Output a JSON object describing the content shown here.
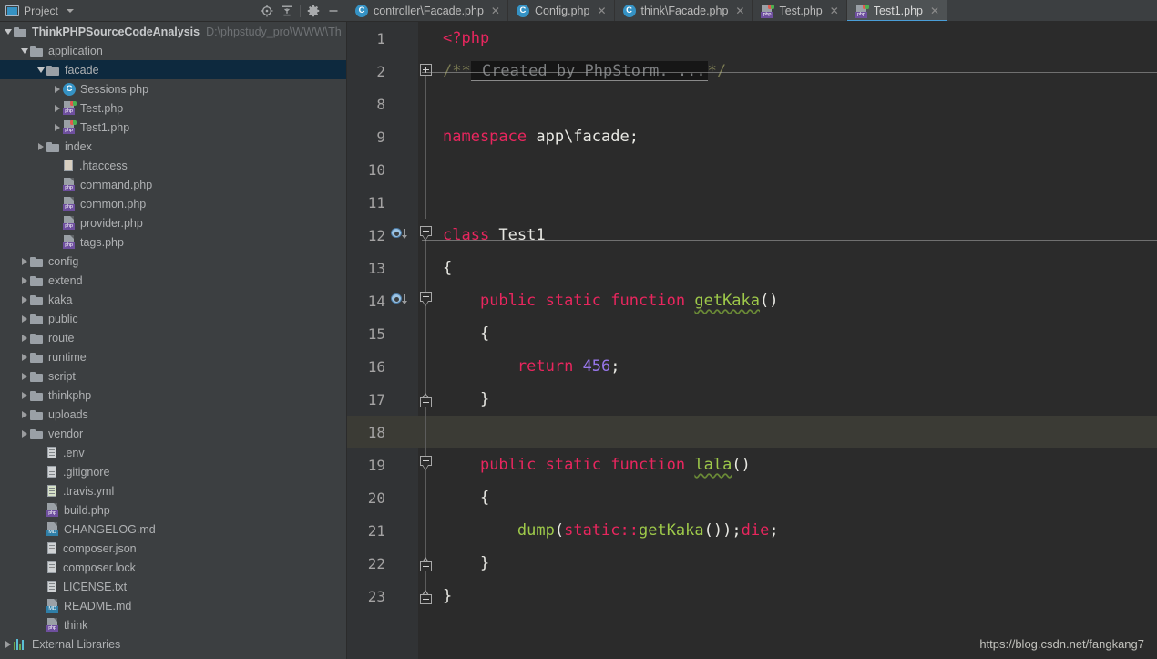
{
  "project_panel": {
    "title": "Project",
    "icon": "project-window-icon",
    "dropdown_icon": "chevron-down-icon",
    "toolbar": [
      {
        "name": "locate-file-icon",
        "label": "Select Opened File"
      },
      {
        "name": "collapse-all-icon",
        "label": "Collapse All"
      },
      {
        "name": "gear-icon",
        "label": "Settings"
      },
      {
        "name": "minimize-icon",
        "label": "Hide"
      }
    ],
    "tree": [
      {
        "label": "ThinkPHPSourceCodeAnalysis",
        "path": "D:\\phpstudy_pro\\WWW\\Th",
        "indent": 0,
        "arrow": "down",
        "icon": "folder-icon",
        "root": true,
        "selected": false
      },
      {
        "label": "application",
        "indent": 1,
        "arrow": "down",
        "icon": "folder-icon",
        "selected": false
      },
      {
        "label": "facade",
        "indent": 2,
        "arrow": "down",
        "icon": "folder-icon",
        "selected": true
      },
      {
        "label": "Sessions.php",
        "indent": 3,
        "arrow": "right",
        "icon": "php-class-icon",
        "selected": false
      },
      {
        "label": "Test.php",
        "indent": 3,
        "arrow": "right",
        "icon": "php-file-icon",
        "selected": false
      },
      {
        "label": "Test1.php",
        "indent": 3,
        "arrow": "right",
        "icon": "php-file-icon",
        "selected": false
      },
      {
        "label": "index",
        "indent": 2,
        "arrow": "right",
        "icon": "folder-icon",
        "selected": false
      },
      {
        "label": ".htaccess",
        "indent": 3,
        "arrow": "none",
        "icon": "htaccess-file-icon",
        "selected": false
      },
      {
        "label": "command.php",
        "indent": 3,
        "arrow": "none",
        "icon": "php-file-icon",
        "selected": false
      },
      {
        "label": "common.php",
        "indent": 3,
        "arrow": "none",
        "icon": "php-file-icon",
        "selected": false
      },
      {
        "label": "provider.php",
        "indent": 3,
        "arrow": "none",
        "icon": "php-file-icon",
        "selected": false
      },
      {
        "label": "tags.php",
        "indent": 3,
        "arrow": "none",
        "icon": "php-file-icon",
        "selected": false
      },
      {
        "label": "config",
        "indent": 1,
        "arrow": "right",
        "icon": "folder-icon",
        "selected": false
      },
      {
        "label": "extend",
        "indent": 1,
        "arrow": "right",
        "icon": "folder-icon",
        "selected": false
      },
      {
        "label": "kaka",
        "indent": 1,
        "arrow": "right",
        "icon": "folder-icon",
        "selected": false
      },
      {
        "label": "public",
        "indent": 1,
        "arrow": "right",
        "icon": "folder-icon",
        "selected": false
      },
      {
        "label": "route",
        "indent": 1,
        "arrow": "right",
        "icon": "folder-icon",
        "selected": false
      },
      {
        "label": "runtime",
        "indent": 1,
        "arrow": "right",
        "icon": "folder-icon",
        "selected": false
      },
      {
        "label": "script",
        "indent": 1,
        "arrow": "right",
        "icon": "folder-icon",
        "selected": false
      },
      {
        "label": "thinkphp",
        "indent": 1,
        "arrow": "right",
        "icon": "folder-icon",
        "selected": false
      },
      {
        "label": "uploads",
        "indent": 1,
        "arrow": "right",
        "icon": "folder-icon",
        "selected": false
      },
      {
        "label": "vendor",
        "indent": 1,
        "arrow": "right",
        "icon": "folder-icon",
        "selected": false
      },
      {
        "label": ".env",
        "indent": 2,
        "arrow": "none",
        "icon": "text-file-icon",
        "selected": false
      },
      {
        "label": ".gitignore",
        "indent": 2,
        "arrow": "none",
        "icon": "text-file-icon",
        "selected": false
      },
      {
        "label": ".travis.yml",
        "indent": 2,
        "arrow": "none",
        "icon": "yaml-file-icon",
        "selected": false
      },
      {
        "label": "build.php",
        "indent": 2,
        "arrow": "none",
        "icon": "php-file-icon",
        "selected": false
      },
      {
        "label": "CHANGELOG.md",
        "indent": 2,
        "arrow": "none",
        "icon": "markdown-file-icon",
        "selected": false
      },
      {
        "label": "composer.json",
        "indent": 2,
        "arrow": "none",
        "icon": "composer-file-icon",
        "selected": false
      },
      {
        "label": "composer.lock",
        "indent": 2,
        "arrow": "none",
        "icon": "composer-file-icon",
        "selected": false
      },
      {
        "label": "LICENSE.txt",
        "indent": 2,
        "arrow": "none",
        "icon": "text-file-icon",
        "selected": false
      },
      {
        "label": "README.md",
        "indent": 2,
        "arrow": "none",
        "icon": "markdown-file-icon",
        "selected": false
      },
      {
        "label": "think",
        "indent": 2,
        "arrow": "none",
        "icon": "php-file-icon",
        "selected": false
      },
      {
        "label": "External Libraries",
        "indent": 0,
        "arrow": "right",
        "icon": "external-libraries-icon",
        "selected": false
      }
    ]
  },
  "editor_tabs": [
    {
      "label": "controller\\Facade.php",
      "icon": "php-class-icon",
      "active": false,
      "close_icon": "close-icon"
    },
    {
      "label": "Config.php",
      "icon": "php-class-icon",
      "active": false,
      "close_icon": "close-icon"
    },
    {
      "label": "think\\Facade.php",
      "icon": "php-class-icon",
      "active": false,
      "close_icon": "close-icon"
    },
    {
      "label": "Test.php",
      "icon": "php-file-icon",
      "active": false,
      "close_icon": "close-icon"
    },
    {
      "label": "Test1.php",
      "icon": "php-file-icon",
      "active": true,
      "close_icon": "close-icon"
    }
  ],
  "editor": {
    "active_line": 18,
    "accent_color": "#4a9ed8",
    "background": "#2b2b2b",
    "gutter_background": "#313335",
    "current_line_background": "#3b3b35",
    "fold_placeholder": " Created by PhpStorm. ...",
    "lines": [
      {
        "num": "1",
        "text": "<?php"
      },
      {
        "num": "2",
        "text": "/** Created by PhpStorm. ...*/"
      },
      {
        "num": "8",
        "text": ""
      },
      {
        "num": "9",
        "text": "namespace app\\facade;"
      },
      {
        "num": "10",
        "text": ""
      },
      {
        "num": "11",
        "text": ""
      },
      {
        "num": "12",
        "text": "class Test1"
      },
      {
        "num": "13",
        "text": "{"
      },
      {
        "num": "14",
        "text": "    public static function getKaka()"
      },
      {
        "num": "15",
        "text": "    {"
      },
      {
        "num": "16",
        "text": "        return 456;"
      },
      {
        "num": "17",
        "text": "    }"
      },
      {
        "num": "18",
        "text": ""
      },
      {
        "num": "19",
        "text": "    public static function lala()"
      },
      {
        "num": "20",
        "text": "    {"
      },
      {
        "num": "21",
        "text": "        dump(static::getKaka());die;"
      },
      {
        "num": "22",
        "text": "    }"
      },
      {
        "num": "23",
        "text": "}"
      }
    ]
  },
  "watermark": "https://blog.csdn.net/fangkang7"
}
